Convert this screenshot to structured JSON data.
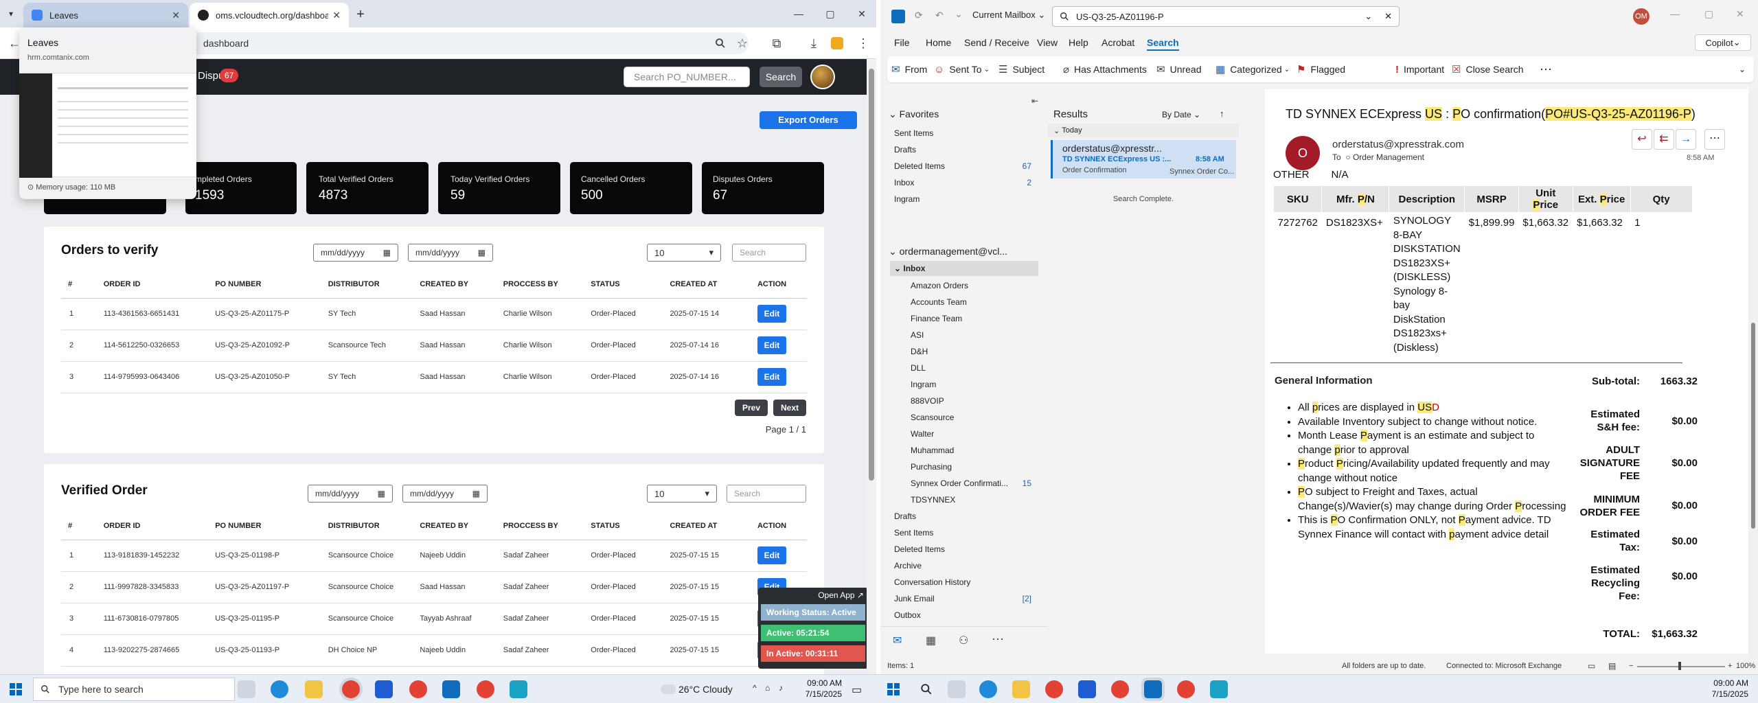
{
  "chrome": {
    "tabs": [
      {
        "title": "Leaves",
        "favicon_color": "#4285f4"
      },
      {
        "title": "oms.vcloudtech.org/dashboard",
        "favicon_color": "#222"
      }
    ],
    "new_tab": "+",
    "window_controls": {
      "minimize": "—",
      "maximize": "▢",
      "close": "✕"
    },
    "address": "dashboard",
    "preview": {
      "title": "Leaves",
      "url": "hrm.comtanix.com",
      "memory": "Memory usage: 110 MB"
    }
  },
  "dashboard": {
    "nav_disputes": "Dispu",
    "nav_disputes_badge": "67",
    "search_placeholder": "Search PO_NUMBER...",
    "search_button": "Search",
    "export_button": "Export Orders",
    "stats": [
      {
        "title": "mpleted Orders",
        "value": "1593"
      },
      {
        "title": "Total Verified Orders",
        "value": "4873"
      },
      {
        "title": "Today Verified Orders",
        "value": "59"
      },
      {
        "title": "Cancelled Orders",
        "value": "500"
      },
      {
        "title": "Disputes Orders",
        "value": "67"
      }
    ],
    "date_placeholder": "mm/dd/yyyy",
    "page_size": "10",
    "table_search_placeholder": "Search",
    "to_verify": {
      "title": "Orders to verify",
      "headers": [
        "#",
        "ORDER ID",
        "PO NUMBER",
        "DISTRIBUTOR",
        "CREATED BY",
        "PROCCESS BY",
        "STATUS",
        "CREATED AT",
        "ACTION"
      ],
      "rows": [
        [
          "1",
          "113-4361563-6651431",
          "US-Q3-25-AZ01175-P",
          "SY Tech",
          "Saad Hassan",
          "Charlie Wilson",
          "Order-Placed",
          "2025-07-15 14"
        ],
        [
          "2",
          "114-5612250-0326653",
          "US-Q3-25-AZ01092-P",
          "Scansource Tech",
          "Saad Hassan",
          "Charlie Wilson",
          "Order-Placed",
          "2025-07-14 16"
        ],
        [
          "3",
          "114-9795993-0643406",
          "US-Q3-25-AZ01050-P",
          "SY Tech",
          "Saad Hassan",
          "Charlie Wilson",
          "Order-Placed",
          "2025-07-14 16"
        ]
      ],
      "edit_label": "Edit",
      "prev_label": "Prev",
      "next_label": "Next",
      "page_info": "Page 1 / 1"
    },
    "verified": {
      "title": "Verified Order",
      "headers": [
        "#",
        "ORDER ID",
        "PO NUMBER",
        "DISTRIBUTOR",
        "CREATED BY",
        "PROCCESS BY",
        "STATUS",
        "CREATED AT",
        "ACTION"
      ],
      "rows": [
        [
          "1",
          "113-9181839-1452232",
          "US-Q3-25-01198-P",
          "Scansource Choice",
          "Najeeb Uddin",
          "Sadaf Zaheer",
          "Order-Placed",
          "2025-07-15 15"
        ],
        [
          "2",
          "111-9997828-3345833",
          "US-Q3-25-AZ01197-P",
          "Scansource Choice",
          "Saad Hassan",
          "Sadaf Zaheer",
          "Order-Placed",
          "2025-07-15 15"
        ],
        [
          "3",
          "111-6730816-0797805",
          "US-Q3-25-01195-P",
          "Scansource Choice",
          "Tayyab Ashraaf",
          "Sadaf Zaheer",
          "Order-Placed",
          "2025-07-15 15"
        ],
        [
          "4",
          "113-9202275-2874665",
          "US-Q3-25-01193-P",
          "DH Choice NP",
          "Najeeb Uddin",
          "Sadaf Zaheer",
          "Order-Placed",
          "2025-07-15 15"
        ]
      ]
    },
    "working_widget": {
      "open_app": "Open App ↗",
      "status": "Working Status: Active",
      "active": "Active: 05:21:54",
      "inactive": "In Active: 00:31:11"
    }
  },
  "outlook": {
    "mailbox_scope": "Current Mailbox",
    "search_query": "US-Q3-25-AZ01196-P",
    "profile_initials": "OM",
    "copilot": "Copilot",
    "menu": [
      "File",
      "Home",
      "Send / Receive",
      "View",
      "Help",
      "Acrobat",
      "Search"
    ],
    "ribbon": [
      "From",
      "Sent To",
      "Subject",
      "Has Attachments",
      "Unread",
      "Categorized",
      "Flagged",
      "Important",
      "Close Search"
    ],
    "favorites_header": "Favorites",
    "favorites": [
      {
        "name": "Sent Items",
        "count": ""
      },
      {
        "name": "Drafts",
        "count": ""
      },
      {
        "name": "Deleted Items",
        "count": "67"
      },
      {
        "name": "Inbox",
        "count": "2"
      },
      {
        "name": "Ingram",
        "count": ""
      }
    ],
    "account": "ordermanagement@vcl...",
    "inbox_label": "Inbox",
    "inbox_folders": [
      {
        "name": "Amazon Orders",
        "count": ""
      },
      {
        "name": "Accounts Team",
        "count": ""
      },
      {
        "name": "Finance Team",
        "count": ""
      },
      {
        "name": "ASI",
        "count": ""
      },
      {
        "name": "D&H",
        "count": ""
      },
      {
        "name": "DLL",
        "count": ""
      },
      {
        "name": "Ingram",
        "count": ""
      },
      {
        "name": "888VOIP",
        "count": ""
      },
      {
        "name": "Scansource",
        "count": ""
      },
      {
        "name": "Walter",
        "count": ""
      },
      {
        "name": "Muhammad",
        "count": ""
      },
      {
        "name": "Purchasing",
        "count": ""
      },
      {
        "name": "Synnex Order Confirmati...",
        "count": "15"
      },
      {
        "name": "TDSYNNEX",
        "count": ""
      }
    ],
    "other_folders": [
      {
        "name": "Drafts",
        "count": ""
      },
      {
        "name": "Sent Items",
        "count": ""
      },
      {
        "name": "Deleted Items",
        "count": ""
      },
      {
        "name": "Archive",
        "count": ""
      },
      {
        "name": "Conversation History",
        "count": ""
      },
      {
        "name": "Junk Email",
        "count": "[2]"
      },
      {
        "name": "Outbox",
        "count": ""
      }
    ],
    "results_title": "Results",
    "sort_by": "By Date",
    "today_label": "Today",
    "message": {
      "sender": "orderstatus@xpresstr...",
      "subject_snippet": "TD SYNNEX ECExpress US :...",
      "time": "8:58 AM",
      "folder": "Order Confirmation",
      "preview": "Synnex Order Co..."
    },
    "search_complete": "Search Complete.",
    "email": {
      "subject_a": "TD SYNNEX ECExpress ",
      "subject_us": "US",
      "subject_b": " : ",
      "subject_p": "P",
      "subject_c": "O confirmation(",
      "subject_po": "PO#",
      "subject_d": "US-Q3-25-AZ01196-P",
      "subject_e": ")",
      "avatar": "O",
      "from": "orderstatus@xpresstrak.com",
      "to_label": "To",
      "to": "Order Management",
      "time": "8:58 AM",
      "other_label": "OTHER",
      "other_value": "N/A",
      "table_headers": [
        "SKU",
        "Mfr. P/N",
        "Description",
        "MSRP",
        "Unit Price",
        "Ext. Price",
        "Qty"
      ],
      "row": [
        "7272762",
        "DS1823XS+",
        "SYNOLOGY 8-BAY DISKSTATION DS1823XS+ (DISKLESS) Synology 8-bay DiskStation DS1823xs+ (Diskless)",
        "$1,899.99",
        "$1,663.32",
        "$1,663.32",
        "1"
      ],
      "general_info": "General Information",
      "bullets": [
        "All prices are displayed in USD",
        "Available Inventory subject to change without notice.",
        "Month Lease Payment is an estimate and subject to change prior to approval",
        "Product Pricing/Availability updated frequently and may change without notice",
        "PO subject to Freight and Taxes, actual Change(s)/Wavier(s) may change during Order Processing",
        "This is PO Confirmation ONLY, not Payment advice. TD Synnex Finance will contact with payment advice detail"
      ],
      "totals": [
        {
          "label": "Sub-total:",
          "value": "1663.32"
        },
        {
          "label": "Estimated S&H fee:",
          "value": "$0.00"
        },
        {
          "label": "ADULT SIGNATURE FEE",
          "value": "$0.00"
        },
        {
          "label": "MINIMUM ORDER FEE",
          "value": "$0.00"
        },
        {
          "label": "Estimated Tax:",
          "value": "$0.00"
        },
        {
          "label": "Estimated Recycling Fee:",
          "value": "$0.00"
        }
      ],
      "total_label": "TOTAL:",
      "total_value": "$1,663.32"
    },
    "status_items": "Items: 1",
    "status_sync": "All folders are up to date.",
    "status_conn": "Connected to: Microsoft Exchange",
    "zoom": "100%"
  },
  "taskbar": {
    "search_placeholder": "Type here to search",
    "weather": "26°C  Cloudy",
    "time": "09:00 AM",
    "date": "7/15/2025"
  }
}
